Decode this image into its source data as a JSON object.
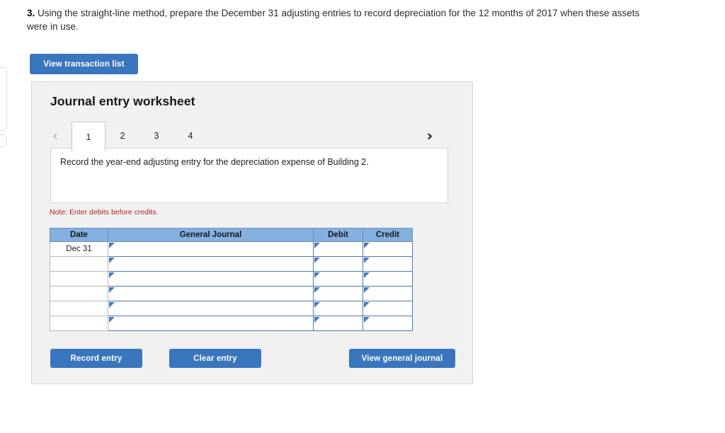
{
  "question": {
    "number": "3.",
    "text": " Using the straight-line method, prepare the December 31 adjusting entries to record depreciation for the 12 months of 2017 when these assets were in use."
  },
  "toolbar": {
    "view_transaction_list_label": "View transaction list"
  },
  "worksheet": {
    "title": "Journal entry worksheet",
    "prev_icon": "‹",
    "next_icon": "›",
    "tabs": [
      {
        "label": "1",
        "active": true
      },
      {
        "label": "2",
        "active": false
      },
      {
        "label": "3",
        "active": false
      },
      {
        "label": "4",
        "active": false
      }
    ],
    "instruction": "Record the year-end adjusting entry for the depreciation expense of Building 2.",
    "note": "Note: Enter debits before credits.",
    "table": {
      "headers": [
        "Date",
        "General Journal",
        "Debit",
        "Credit"
      ],
      "rows": [
        {
          "date": "Dec 31",
          "general_journal": "",
          "debit": "",
          "credit": ""
        },
        {
          "date": "",
          "general_journal": "",
          "debit": "",
          "credit": ""
        },
        {
          "date": "",
          "general_journal": "",
          "debit": "",
          "credit": ""
        },
        {
          "date": "",
          "general_journal": "",
          "debit": "",
          "credit": ""
        },
        {
          "date": "",
          "general_journal": "",
          "debit": "",
          "credit": ""
        },
        {
          "date": "",
          "general_journal": "",
          "debit": "",
          "credit": ""
        }
      ]
    },
    "actions": {
      "record_entry_label": "Record entry",
      "clear_entry_label": "Clear entry",
      "view_general_journal_label": "View general journal"
    }
  },
  "colors": {
    "primary_blue": "#3a76bd",
    "table_header_blue": "#84b0e0",
    "cell_border_blue": "#4a7ab3",
    "panel_bg": "#f1f1f1",
    "note_red": "#b22222"
  }
}
